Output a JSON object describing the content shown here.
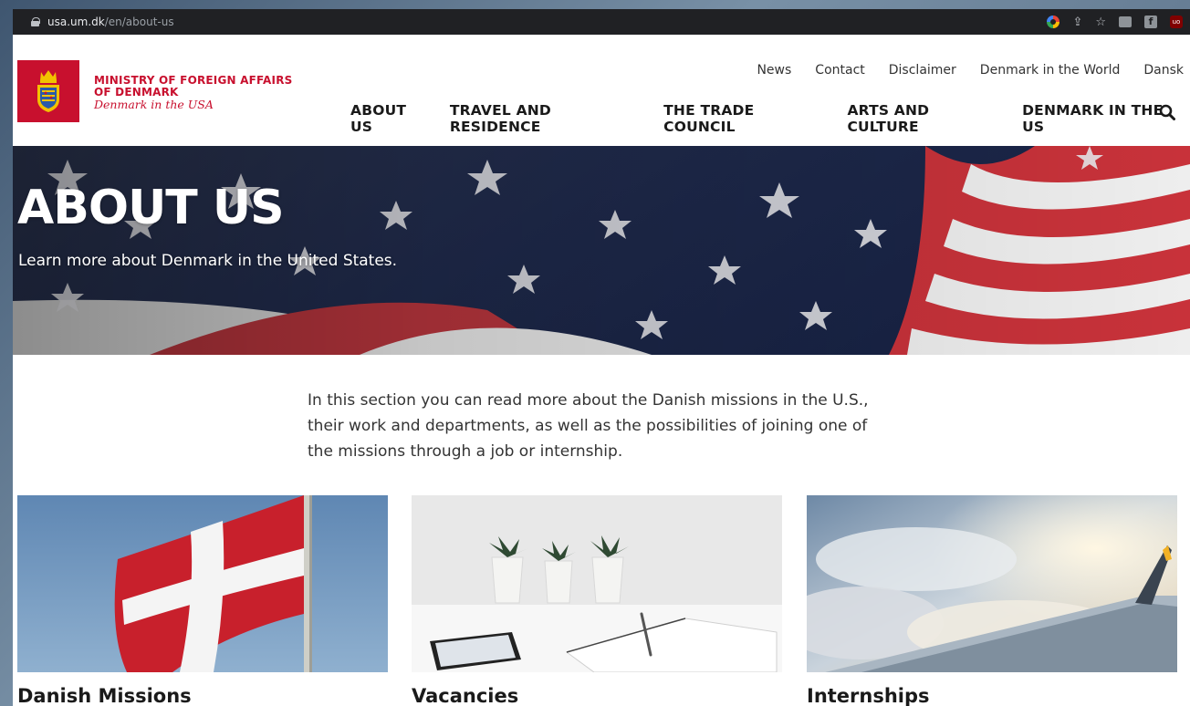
{
  "browser": {
    "url_host": "usa.um.dk",
    "url_path": "/en/about-us",
    "ublock_badge": "uo"
  },
  "site": {
    "logo": {
      "line1": "MINISTRY OF FOREIGN AFFAIRS",
      "line2": "OF DENMARK",
      "line3": "Denmark in the USA",
      "color": "#c8102e"
    },
    "top_links": [
      "News",
      "Contact",
      "Disclaimer",
      "Denmark in the World",
      "Dansk"
    ],
    "main_nav": [
      "ABOUT US",
      "TRAVEL AND RESIDENCE",
      "THE TRADE COUNCIL",
      "ARTS AND CULTURE",
      "DENMARK IN THE US"
    ],
    "search_icon": "search-icon"
  },
  "hero": {
    "title": "ABOUT US",
    "subtitle": "Learn more about Denmark in the United States."
  },
  "intro": "In this section you can read more about the Danish missions in the U.S., their work and departments, as well as the possibilities of joining one of the missions through a job or internship.",
  "cards": [
    {
      "title": "Danish Missions"
    },
    {
      "title": "Vacancies"
    },
    {
      "title": "Internships"
    }
  ]
}
